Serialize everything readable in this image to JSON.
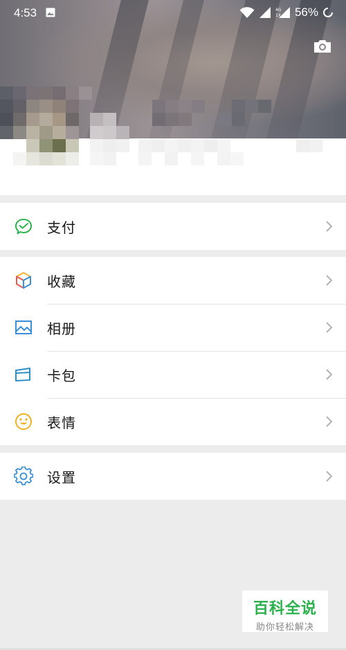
{
  "status_bar": {
    "time": "4:53",
    "battery": "56%"
  },
  "header": {
    "camera_icon": "camera-icon"
  },
  "menu_groups": [
    {
      "items": [
        {
          "label": "支付",
          "icon": "wechat-pay-icon",
          "color": "#2bb24c"
        }
      ]
    },
    {
      "items": [
        {
          "label": "收藏",
          "icon": "favorites-cube-icon",
          "color": "#e6a23c"
        },
        {
          "label": "相册",
          "icon": "album-picture-icon",
          "color": "#3a8fd6"
        },
        {
          "label": "卡包",
          "icon": "card-wallet-icon",
          "color": "#2f8fc4"
        },
        {
          "label": "表情",
          "icon": "emoji-smile-icon",
          "color": "#f0b022"
        }
      ]
    },
    {
      "items": [
        {
          "label": "设置",
          "icon": "settings-gear-icon",
          "color": "#3a8fd6"
        }
      ]
    }
  ],
  "watermark": {
    "title": "百科全说",
    "subtitle": "助你轻松解决"
  }
}
